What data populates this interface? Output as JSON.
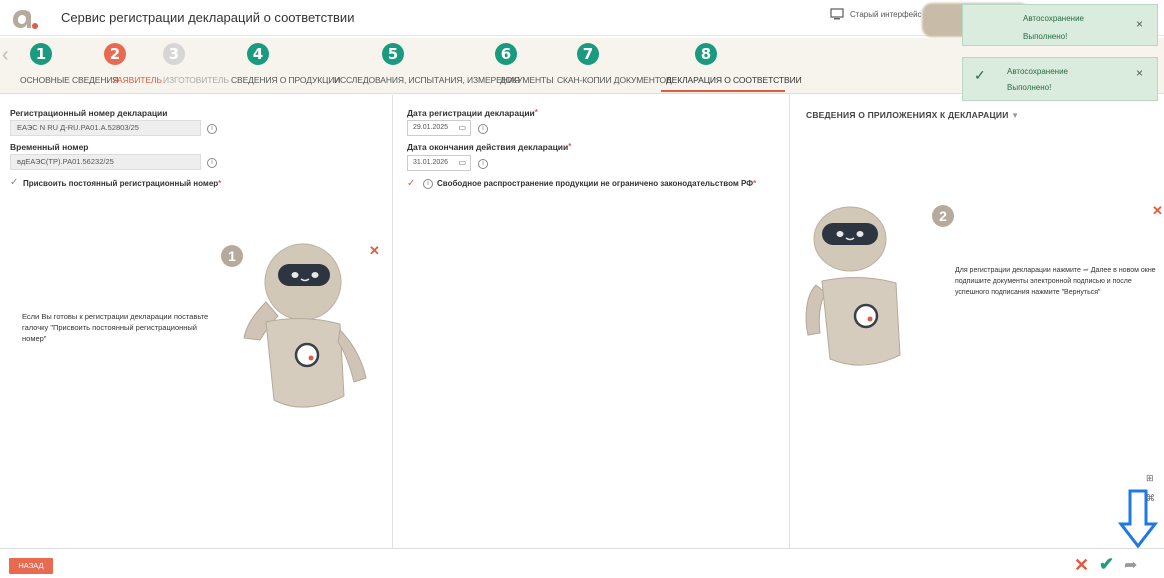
{
  "header": {
    "title": "Сервис регистрации деклараций о соответствии",
    "old_ui": "Старый интерфейс"
  },
  "steps": [
    {
      "num": "1",
      "label": "ОСНОВНЫЕ СВЕДЕНИЯ",
      "color": "#1a9a7e"
    },
    {
      "num": "2",
      "label": "ЗАЯВИТЕЛЬ",
      "color": "#e86a50"
    },
    {
      "num": "3",
      "label": "ИЗГОТОВИТЕЛЬ",
      "color": "#d6d6d6"
    },
    {
      "num": "4",
      "label": "СВЕДЕНИЯ О ПРОДУКЦИИ",
      "color": "#1a9a7e"
    },
    {
      "num": "5",
      "label": "ИССЛЕДОВАНИЯ, ИСПЫТАНИЯ, ИЗМЕРЕНИЯ",
      "color": "#1a9a7e"
    },
    {
      "num": "6",
      "label": "ДОКУМЕНТЫ",
      "color": "#1a9a7e"
    },
    {
      "num": "7",
      "label": "СКАН-КОПИИ ДОКУМЕНТОВ",
      "color": "#1a9a7e"
    },
    {
      "num": "8",
      "label": "ДЕКЛАРАЦИЯ О СООТВЕТСТВИИ",
      "color": "#1a9a7e"
    }
  ],
  "toasts": [
    {
      "title": "Автосохранение",
      "text": "Выполнено!"
    },
    {
      "title": "Автосохранение",
      "text": "Выполнено!"
    }
  ],
  "left": {
    "reg_label": "Регистрационный номер декларации",
    "reg_value": "ЕАЭС N RU Д-RU.РА01.А.52803/25",
    "temp_label": "Временный номер",
    "temp_value": "вдЕАЭС(ТР).РА01.56232/25",
    "assign_label": "Присвоить постоянный регистрационный номер",
    "help_num": "1",
    "help_text": "Если Вы готовы к регистрации декларации поставьте галочку \"Присвоить постоянный регистрационный номер\""
  },
  "middle": {
    "reg_date_label": "Дата регистрации декларации",
    "reg_date": "29.01.2025",
    "end_date_label": "Дата окончания действия декларации",
    "end_date": "31.01.2026",
    "free_label": "Свободное распространение продукции не ограничено законодательством РФ"
  },
  "right": {
    "section_title": "СВЕДЕНИЯ О ПРИЛОЖЕНИЯХ К ДЕКЛАРАЦИИ",
    "help_num": "2",
    "help_text_1": "Для регистрации декларации нажмите",
    "help_text_2": "Далее в новом окне подпишите документы электронной подписью и после успешного подписания нажмите \"Вернуться\""
  },
  "footer": {
    "back_label": "НАЗАД"
  }
}
